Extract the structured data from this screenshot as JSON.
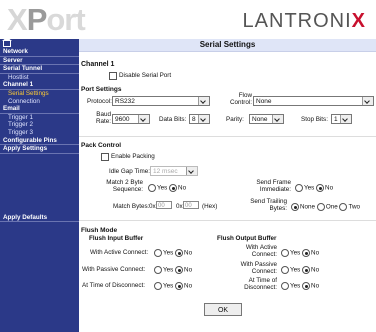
{
  "header": {
    "logo_x": "X",
    "logo_o": "P",
    "logo_rest": "ort",
    "brand": "LANTRONI",
    "brand_x": "X"
  },
  "sidebar": {
    "items": [
      {
        "label": "Network"
      },
      {
        "label": "Server"
      },
      {
        "label": "Serial Tunnel"
      },
      {
        "label": "Hostlist"
      },
      {
        "label": "Channel 1"
      },
      {
        "label": "Serial Settings"
      },
      {
        "label": "Connection"
      },
      {
        "label": "Email"
      },
      {
        "label": "Trigger 1"
      },
      {
        "label": "Trigger 2"
      },
      {
        "label": "Trigger 3"
      },
      {
        "label": "Configurable Pins"
      },
      {
        "label": "Apply Settings"
      },
      {
        "label": "Apply Defaults"
      }
    ]
  },
  "main": {
    "title": "Serial Settings",
    "channel": "Channel 1",
    "disable_label": "Disable Serial Port",
    "port_settings": "Port Settings",
    "protocol_label": "Protocol:",
    "protocol_value": "RS232",
    "flow_label": "Flow Control:",
    "flow_value": "None",
    "baud_label": "Baud Rate:",
    "baud_value": "9600",
    "databits_label": "Data Bits:",
    "databits_value": "8",
    "parity_label": "Parity:",
    "parity_value": "None",
    "stopbits_label": "Stop Bits:",
    "stopbits_value": "1",
    "pack_control": "Pack Control",
    "enable_packing": "Enable Packing",
    "idle_gap_label": "Idle Gap Time:",
    "idle_gap_value": "12 msec",
    "match2_label": "Match 2 Byte Sequence:",
    "sendframe_label": "Send Frame Immediate:",
    "match_bytes_label": "Match Bytes:",
    "hex_prefix": "0x",
    "match_byte_1": "00",
    "match_byte_2": "00",
    "hex_suffix": "(Hex)",
    "send_trailing_label": "Send Trailing Bytes:",
    "yes": "Yes",
    "no": "No",
    "none": "None",
    "one": "One",
    "two": "Two",
    "flush_mode": "Flush Mode",
    "flush_input": "Flush Input Buffer",
    "flush_output": "Flush Output Buffer",
    "active_connect_in": "With Active Connect:",
    "passive_connect_in": "With Passive Connect:",
    "disconnect_in": "At Time of Disconnect:",
    "active_connect_out": "With Active Connect:",
    "passive_connect_out": "With Passive Connect:",
    "disconnect_out": "At Time of Disconnect:",
    "ok": "OK"
  },
  "colors": {
    "sidebar": "#2b3988",
    "title_bar": "#dfe5f7",
    "active_item": "#ffcc33",
    "brand_x": "#c8102e"
  }
}
